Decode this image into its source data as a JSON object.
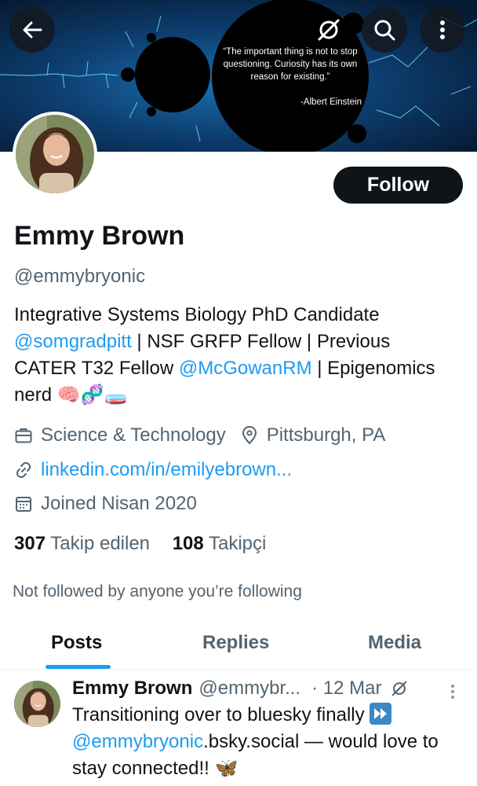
{
  "header": {
    "quote_text": "“The important thing is not to stop questioning. Curiosity has its own reason for existing.”",
    "quote_author": "-Albert Einstein",
    "back_icon": "arrow-left-icon",
    "grok_icon": "grok-icon",
    "search_icon": "search-icon",
    "more_icon": "more-vertical-icon"
  },
  "profile": {
    "follow_label": "Follow",
    "name": "Emmy Brown",
    "handle": "@emmybryonic",
    "bio": {
      "line1": "Integrative Systems Biology PhD Candidate",
      "mention1": "@somgradpitt",
      "line2_rest": " | NSF GRFP Fellow | Previous",
      "line3_start": "CATER T32 Fellow ",
      "mention2": "@McGowanRM",
      "line3_end": " | Epigenomics",
      "line4": "nerd ",
      "emojis": "🧠🧬🧫"
    },
    "category": "Science & Technology",
    "location": "Pittsburgh, PA",
    "website": "linkedin.com/in/emilyebrown...",
    "joined": "Joined Nisan 2020",
    "following_count": "307",
    "following_label": "Takip edilen",
    "followers_count": "108",
    "followers_label": "Takipçi",
    "not_followed_text": "Not followed by anyone you’re following"
  },
  "tabs": [
    {
      "label": "Posts",
      "active": true
    },
    {
      "label": "Replies",
      "active": false
    },
    {
      "label": "Media",
      "active": false
    }
  ],
  "post": {
    "author": "Emmy Brown",
    "handle": "@emmybr...",
    "time": "· 12 Mar",
    "text_line1": "Transitioning over to bluesky finally ",
    "mention": "@emmybryonic",
    "text_after_mention": ".bsky.social — would love to stay connected!! ",
    "end_emoji": "🦋"
  },
  "colors": {
    "accent": "#1d9bf0",
    "text_primary": "#0f1419",
    "text_secondary": "#536471",
    "button_dark": "#0f1419"
  }
}
